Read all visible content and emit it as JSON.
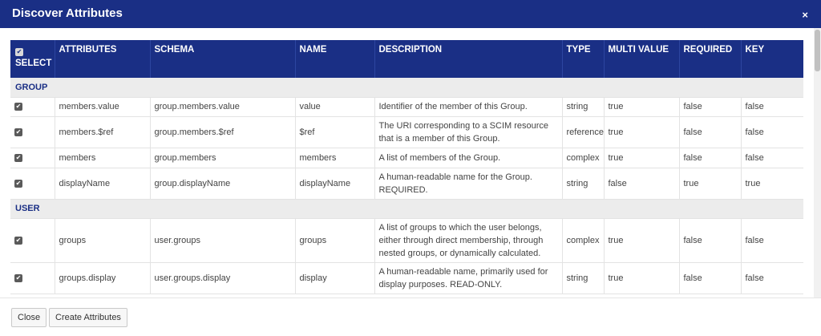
{
  "dialog": {
    "title": "Discover Attributes",
    "close_glyph": "×"
  },
  "table": {
    "headers": {
      "select": "SELECT",
      "attributes": "ATTRIBUTES",
      "schema": "SCHEMA",
      "name": "NAME",
      "description": "DESCRIPTION",
      "type": "TYPE",
      "multi_value": "MULTI VALUE",
      "required": "REQUIRED",
      "key": "KEY"
    },
    "groups": [
      {
        "label": "GROUP",
        "rows": [
          {
            "checked": true,
            "attribute": "members.value",
            "schema": "group.members.value",
            "name": "value",
            "description": "Identifier of the member of this Group.",
            "type": "string",
            "multi_value": "true",
            "required": "false",
            "key": "false"
          },
          {
            "checked": true,
            "attribute": "members.$ref",
            "schema": "group.members.$ref",
            "name": "$ref",
            "description": "The URI corresponding to a SCIM resource that is a member of this Group.",
            "type": "reference",
            "multi_value": "true",
            "required": "false",
            "key": "false"
          },
          {
            "checked": true,
            "attribute": "members",
            "schema": "group.members",
            "name": "members",
            "description": "A list of members of the Group.",
            "type": "complex",
            "multi_value": "true",
            "required": "false",
            "key": "false"
          },
          {
            "checked": true,
            "attribute": "displayName",
            "schema": "group.displayName",
            "name": "displayName",
            "description": "A human-readable name for the Group. REQUIRED.",
            "type": "string",
            "multi_value": "false",
            "required": "true",
            "key": "true"
          }
        ]
      },
      {
        "label": "USER",
        "rows": [
          {
            "checked": true,
            "attribute": "groups",
            "schema": "user.groups",
            "name": "groups",
            "description": "A list of groups to which the user belongs, either through direct membership, through nested groups, or dynamically calculated.",
            "type": "complex",
            "multi_value": "true",
            "required": "false",
            "key": "false"
          },
          {
            "checked": true,
            "attribute": "groups.display",
            "schema": "user.groups.display",
            "name": "display",
            "description": "A human-readable name, primarily used for display purposes. READ-ONLY.",
            "type": "string",
            "multi_value": "true",
            "required": "false",
            "key": "false"
          }
        ]
      }
    ]
  },
  "footer": {
    "close_label": "Close",
    "create_label": "Create Attributes"
  },
  "icons": {
    "checkbox": "checkbox-checked-icon",
    "close": "close-icon"
  },
  "colors": {
    "header_blue": "#1a2f85",
    "group_row_bg": "#ececec"
  }
}
